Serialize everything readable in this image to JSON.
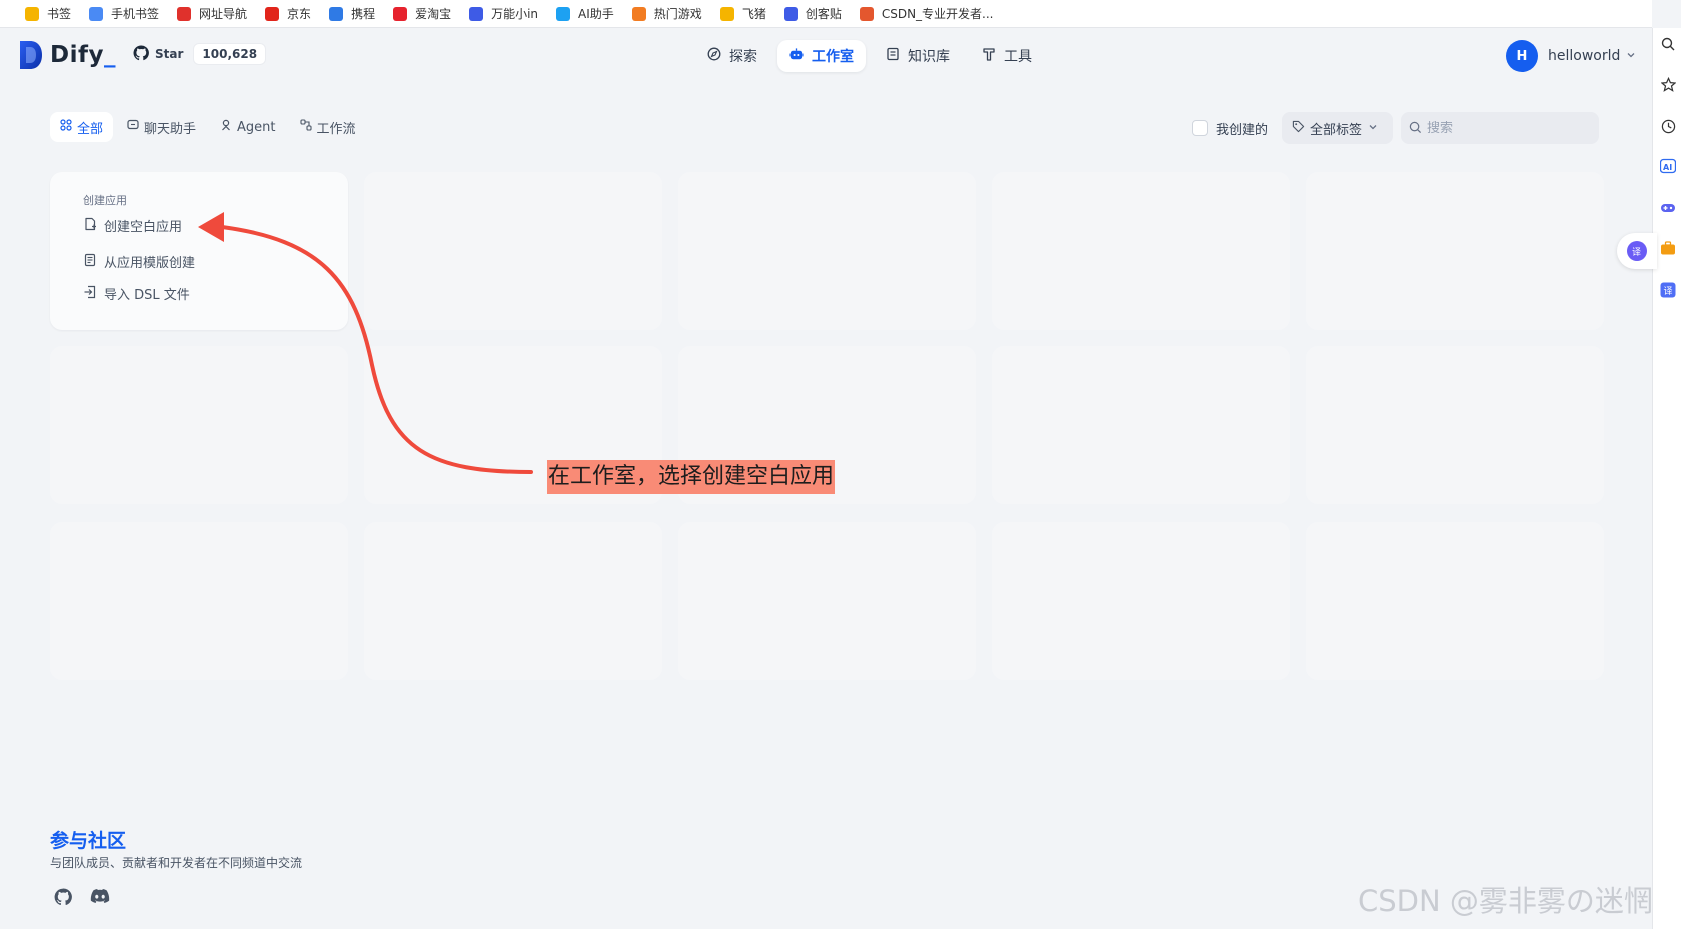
{
  "bookmarks": [
    {
      "label": "书签",
      "color": "#f5b400",
      "icon": "star-icon"
    },
    {
      "label": "手机书签",
      "color": "#4a8af4",
      "icon": "phone-bookmark-icon"
    },
    {
      "label": "网址导航",
      "color": "#e0312c",
      "icon": "nav-site-icon"
    },
    {
      "label": "京东",
      "color": "#e1251b",
      "icon": "jd-icon"
    },
    {
      "label": "携程",
      "color": "#2f7ae5",
      "icon": "ctrip-icon"
    },
    {
      "label": "爱淘宝",
      "color": "#e6232e",
      "icon": "taobao-icon"
    },
    {
      "label": "万能小in",
      "color": "#3e5be6",
      "icon": "robot-icon"
    },
    {
      "label": "AI助手",
      "color": "#1da1f2",
      "icon": "ai-assistant-icon"
    },
    {
      "label": "热门游戏",
      "color": "#f27c22",
      "icon": "game-icon"
    },
    {
      "label": "飞猪",
      "color": "#f5b400",
      "icon": "fliggy-icon"
    },
    {
      "label": "创客贴",
      "color": "#3e5be6",
      "icon": "chuangkit-icon"
    },
    {
      "label": "CSDN_专业开发者...",
      "color": "#e4572e",
      "icon": "csdn-icon"
    }
  ],
  "header": {
    "logo_text": "Dify",
    "logo_cursor": "_",
    "github_star_label": "Star",
    "github_star_count": "100,628",
    "nav": [
      {
        "label": "探索",
        "icon": "compass-icon"
      },
      {
        "label": "工作室",
        "icon": "robot-icon",
        "active": true
      },
      {
        "label": "知识库",
        "icon": "book-icon"
      },
      {
        "label": "工具",
        "icon": "hammer-icon"
      }
    ],
    "user": {
      "initial": "H",
      "name": "helloworld"
    }
  },
  "filters": {
    "tabs": [
      {
        "label": "全部",
        "icon": "grid-icon",
        "active": true
      },
      {
        "label": "聊天助手",
        "icon": "chat-icon"
      },
      {
        "label": "Agent",
        "icon": "agent-icon"
      },
      {
        "label": "工作流",
        "icon": "workflow-icon"
      }
    ],
    "mine_label": "我创建的",
    "tag_select_label": "全部标签",
    "search_placeholder": "搜索"
  },
  "create_card": {
    "title": "创建应用",
    "options": [
      {
        "label": "创建空白应用",
        "icon": "file-plus-icon"
      },
      {
        "label": "从应用模版创建",
        "icon": "template-icon"
      },
      {
        "label": "导入 DSL 文件",
        "icon": "import-icon"
      }
    ]
  },
  "annotation": {
    "text": "在工作室，选择创建空白应用",
    "arrow_color": "#ef4a3c"
  },
  "community": {
    "title": "参与社区",
    "description": "与团队成员、贡献者和开发者在不同频道中交流"
  },
  "watermark": "CSDN @雾非雾の迷惘",
  "colors": {
    "accent": "#155eef",
    "background": "#f2f4f7"
  }
}
